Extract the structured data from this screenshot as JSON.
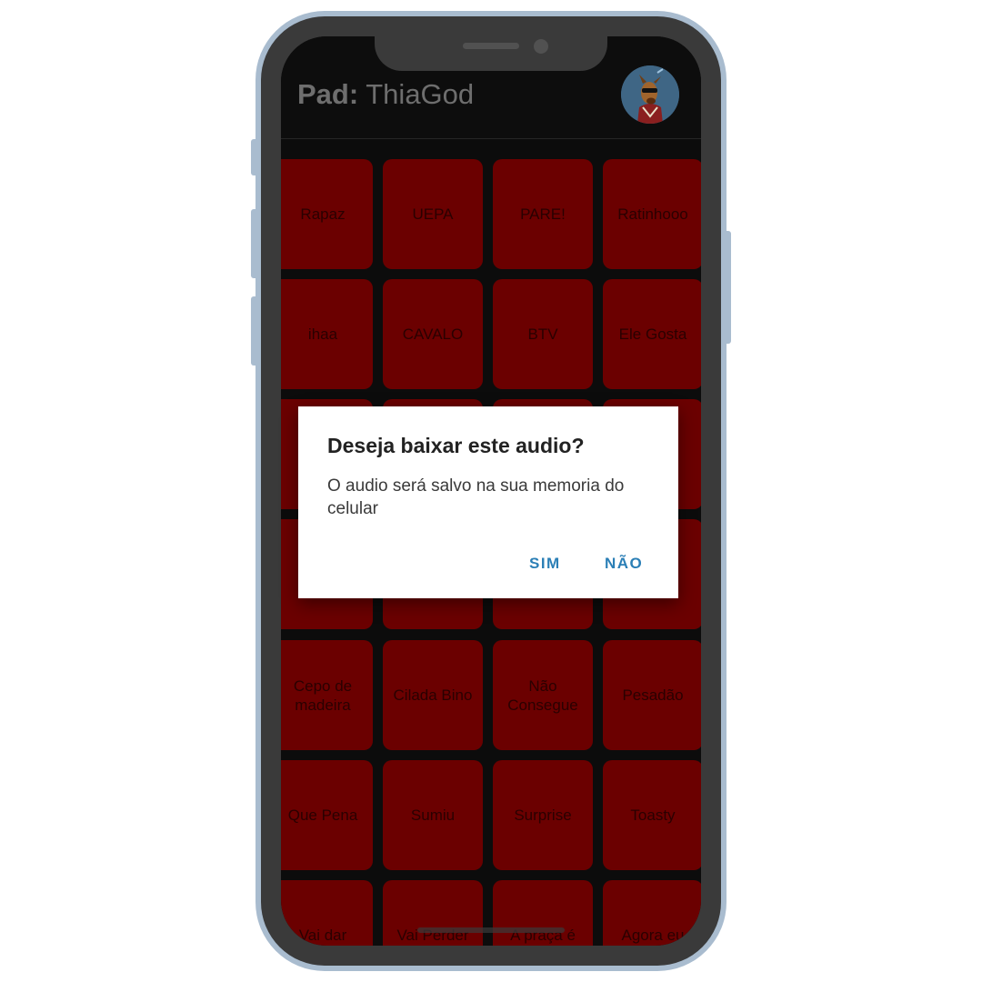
{
  "app": {
    "title_prefix": "Pad:",
    "title_name": "ThiaGod"
  },
  "pads": [
    {
      "label": "Rapaz"
    },
    {
      "label": "UEPA"
    },
    {
      "label": "PARE!"
    },
    {
      "label": "Ratinhooo"
    },
    {
      "label": "ihaa"
    },
    {
      "label": "CAVALO"
    },
    {
      "label": "BTV"
    },
    {
      "label": "Ele Gosta"
    },
    {
      "label": ""
    },
    {
      "label": ""
    },
    {
      "label": ""
    },
    {
      "label": ""
    },
    {
      "label": ""
    },
    {
      "label": ""
    },
    {
      "label": ""
    },
    {
      "label": ""
    },
    {
      "label": "Cepo de madeira"
    },
    {
      "label": "Cilada Bino"
    },
    {
      "label": "Não Consegue"
    },
    {
      "label": "Pesadão"
    },
    {
      "label": "Que Pena"
    },
    {
      "label": "Sumiu"
    },
    {
      "label": "Surprise"
    },
    {
      "label": "Toasty"
    },
    {
      "label": "Vai dar"
    },
    {
      "label": "Vai Perder"
    },
    {
      "label": "A praça é"
    },
    {
      "label": "Agora eu"
    }
  ],
  "dialog": {
    "title": "Deseja baixar este audio?",
    "message": "O audio será salvo na sua memoria do celular",
    "confirm_label": "SIM",
    "cancel_label": "NÃO"
  },
  "colors": {
    "pad": "#6b0000",
    "accent": "#2b7fb6",
    "frame": "#a9bccf"
  }
}
